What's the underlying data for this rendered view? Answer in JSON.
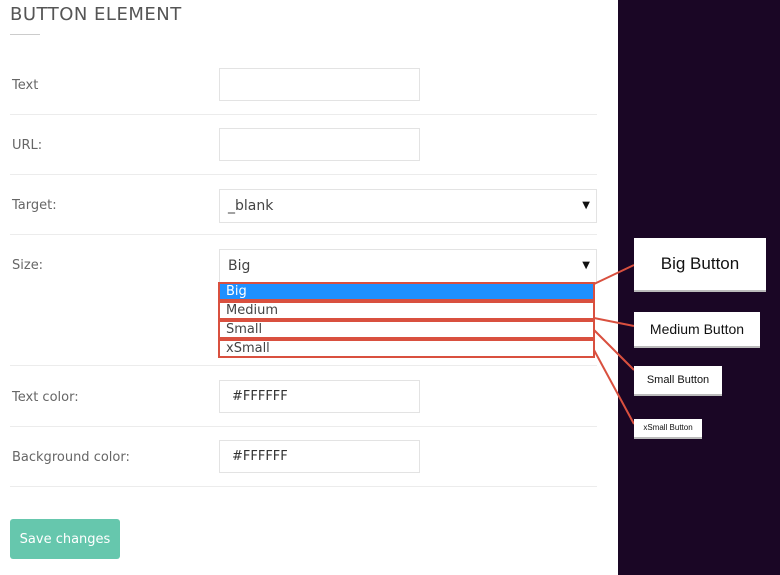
{
  "title": "BUTTON ELEMENT",
  "fields": {
    "text_label": "Text",
    "text_value": "",
    "url_label": "URL:",
    "url_value": "",
    "target_label": "Target:",
    "target_value": "_blank",
    "size_label": "Size:",
    "size_value": "Big",
    "text_color_label": "Text color:",
    "text_color_value": "#FFFFFF",
    "bg_color_label": "Background color:",
    "bg_color_value": "#FFFFFF"
  },
  "size_options": [
    "Big",
    "Medium",
    "Small",
    "xSmall"
  ],
  "save_label": "Save changes",
  "callouts": {
    "big": "Big Button",
    "medium": "Medium Button",
    "small": "Small Button",
    "xsmall": "xSmall Button"
  },
  "colors": {
    "accent": "#66c7ad",
    "highlight": "#1e90ff",
    "callout_line": "#d9503f",
    "dark_bg": "#1a0625"
  },
  "icons": {
    "caret": "dropdown-caret-icon"
  }
}
